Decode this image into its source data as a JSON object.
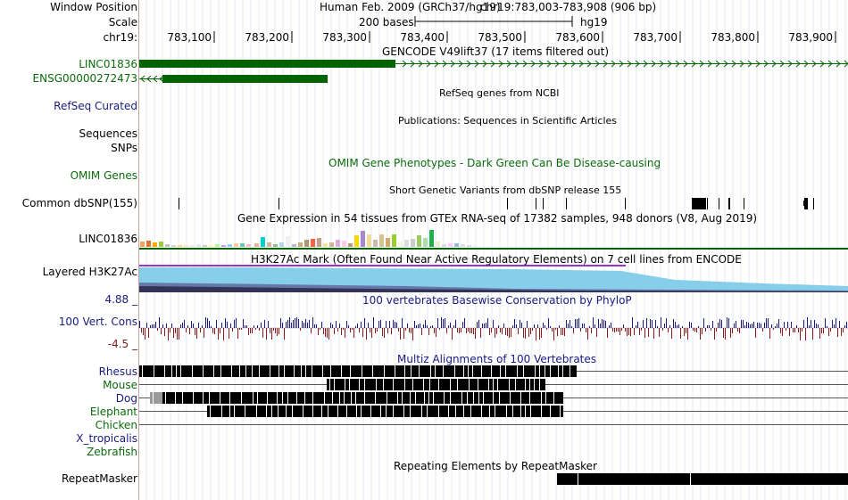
{
  "left_labels": {
    "window_position": "Window Position",
    "scale": "Scale",
    "chrom": "chr19:",
    "linc_track": "LINC01836",
    "ensg": "ENSG00000272473",
    "refseq": "RefSeq Curated",
    "sequences": "Sequences",
    "snps": "SNPs",
    "omim": "OMIM Genes",
    "dbsnp": "Common dbSNP(155)",
    "gtex_gene": "LINC01836",
    "layered": "Layered H3K27Ac",
    "cons_max": "4.88 _",
    "cons_label": "100 Vert. Cons",
    "cons_min": "-4.5 _",
    "species": [
      "Rhesus",
      "Mouse",
      "Dog",
      "Elephant",
      "Chicken",
      "X_tropicalis",
      "Zebrafish"
    ],
    "repeatmasker": "RepeatMasker"
  },
  "header": {
    "assembly": "Human Feb. 2009 (GRCh37/hg19)",
    "position": "chr19:783,003-783,908 (906 bp)",
    "scale_text": "200 bases",
    "scale_db": "hg19",
    "ticks": [
      "783,100",
      "783,200",
      "783,300",
      "783,400",
      "783,500",
      "783,600",
      "783,700",
      "783,800",
      "783,900"
    ]
  },
  "track_titles": {
    "gencode": "GENCODE V49lift37 (17 items filtered out)",
    "refseq": "RefSeq genes from NCBI",
    "publications": "Publications: Sequences in Scientific Articles",
    "omim": "OMIM Gene Phenotypes - Dark Green Can Be Disease-causing",
    "dbsnp": "Short Genetic Variants from dbSNP release 155",
    "gtex": "Gene Expression in 54 tissues from GTEx RNA-seq of 17382 samples, 948 donors (V8, Aug 2019)",
    "h3k27ac": "H3K27Ac Mark (Often Found Near Active Regulatory Elements) on 7 cell lines from ENCODE",
    "cons": "100 vertebrates Basewise Conservation by PhyloP",
    "multiz": "Multiz Alignments of 100 Vertebrates",
    "rmsk": "Repeating Elements by RepeatMasker"
  },
  "colors": {
    "gene_green": "#006400",
    "label_navy": "#1a1a80",
    "label_green": "#0a6b0a",
    "h3k27ac_blue": "#87ceeb",
    "cons_pos": "#1a1a80",
    "cons_neg": "#8b1a1a"
  }
}
